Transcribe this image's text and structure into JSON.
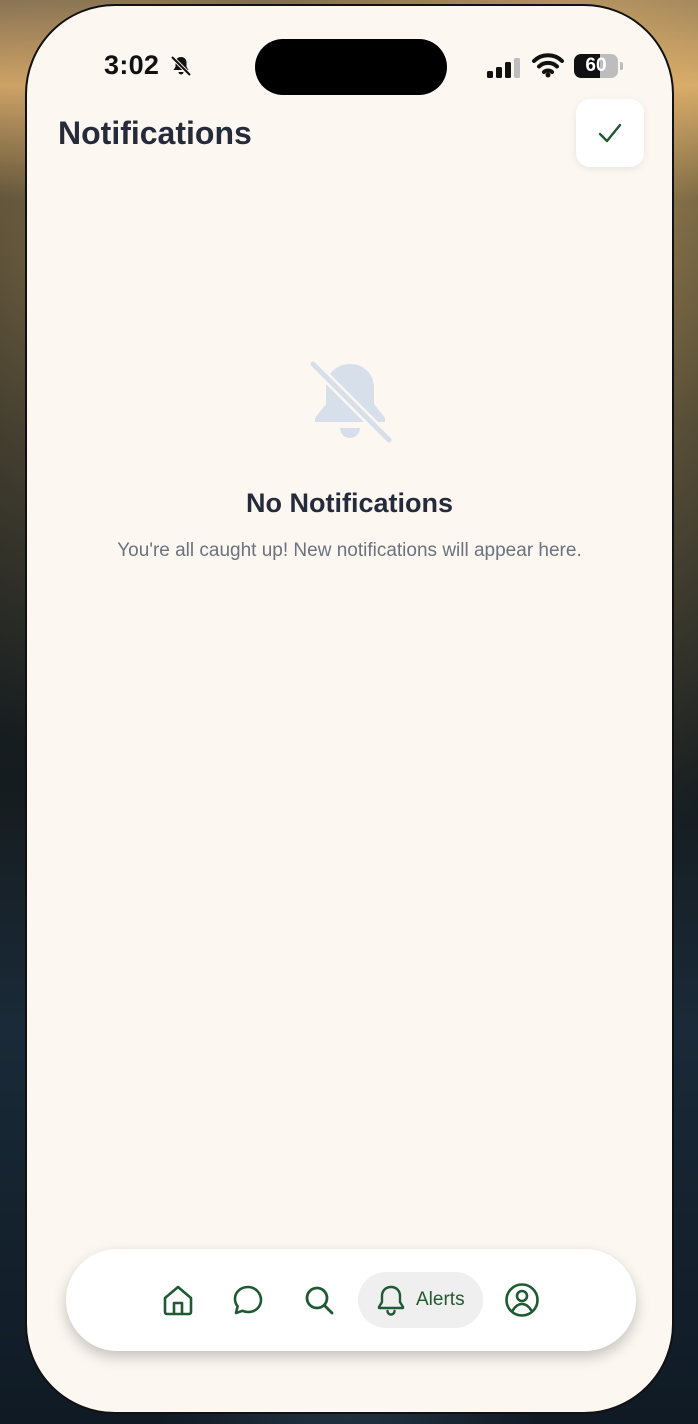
{
  "status_bar": {
    "time": "3:02",
    "battery": "60",
    "battery_level": 0.6
  },
  "header": {
    "title": "Notifications"
  },
  "empty_state": {
    "title": "No Notifications",
    "message": "You're all caught up! New notifications will appear here."
  },
  "tab_bar": {
    "active": "alerts",
    "alerts_label": "Alerts"
  },
  "colors": {
    "background": "#fcf7f1",
    "title_text": "#262b3b",
    "muted_text": "#6b7280",
    "accent_green": "#1f5a32",
    "empty_icon": "#d7e0ea"
  }
}
